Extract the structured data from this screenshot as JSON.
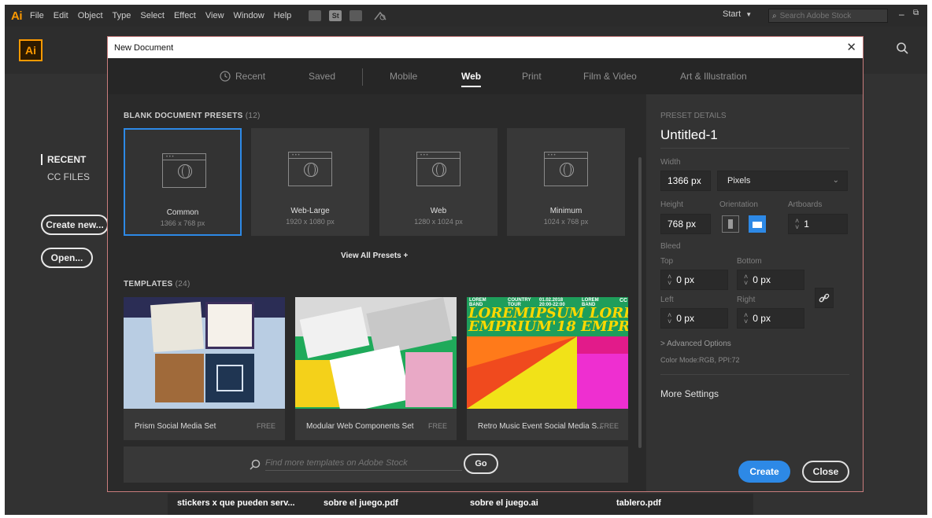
{
  "menubar": {
    "logo": "Ai",
    "items": [
      "File",
      "Edit",
      "Object",
      "Type",
      "Select",
      "Effect",
      "View",
      "Window",
      "Help"
    ],
    "start_label": "Start",
    "stock_search_placeholder": "Search Adobe Stock",
    "toolbar_st_label": "St"
  },
  "home": {
    "logo": "Ai",
    "nav_recent": "RECENT",
    "nav_cc_files": "CC FILES",
    "create_new_label": "Create new...",
    "open_label": "Open...",
    "recent_files": [
      "stickers x que pueden serv...",
      "sobre el juego.pdf",
      "sobre el juego.ai",
      "tablero.pdf"
    ]
  },
  "dialog": {
    "title": "New Document",
    "tabs": [
      {
        "label": "Recent",
        "active": false
      },
      {
        "label": "Saved",
        "active": false
      },
      {
        "label": "Mobile",
        "active": false
      },
      {
        "label": "Web",
        "active": true
      },
      {
        "label": "Print",
        "active": false
      },
      {
        "label": "Film & Video",
        "active": false
      },
      {
        "label": "Art & Illustration",
        "active": false
      }
    ],
    "blank_presets_label": "BLANK DOCUMENT PRESETS",
    "blank_presets_count": "(12)",
    "presets": [
      {
        "name": "Common",
        "size": "1366 x 768 px",
        "selected": true
      },
      {
        "name": "Web-Large",
        "size": "1920 x 1080 px",
        "selected": false
      },
      {
        "name": "Web",
        "size": "1280 x 1024 px",
        "selected": false
      },
      {
        "name": "Minimum",
        "size": "1024 x 768 px",
        "selected": false
      }
    ],
    "view_all_label": "View All Presets +",
    "templates_label": "TEMPLATES",
    "templates_count": "(24)",
    "templates": [
      {
        "name": "Prism Social Media Set",
        "badge": "FREE"
      },
      {
        "name": "Modular Web Components Set",
        "badge": "FREE"
      },
      {
        "name": "Retro Music Event Social Media S...",
        "badge": "FREE"
      }
    ],
    "retro_thumb_text": {
      "lorem": "LOREM",
      "band": "BAND",
      "country": "COUNTRY",
      "tour": "TOUR",
      "date": "01.02.2018",
      "time": "20:00-22:00",
      "cc": "CC",
      "headline1": "LOREMIPSUM",
      "headline1b": "LOREM",
      "headline2": "EMPRIUM'18",
      "headline2b": "EMPRI"
    },
    "template_search_placeholder": "Find more templates on Adobe Stock",
    "go_label": "Go"
  },
  "preset_details": {
    "section_label": "PRESET DETAILS",
    "doc_name": "Untitled-1",
    "width_label": "Width",
    "width_value": "1366 px",
    "units": "Pixels",
    "height_label": "Height",
    "height_value": "768 px",
    "orientation_label": "Orientation",
    "artboards_label": "Artboards",
    "artboards_value": "1",
    "bleed_label": "Bleed",
    "top_label": "Top",
    "top_value": "0 px",
    "bottom_label": "Bottom",
    "bottom_value": "0 px",
    "left_label": "Left",
    "left_value": "0 px",
    "right_label": "Right",
    "right_value": "0 px",
    "advanced_options": "> Advanced Options",
    "color_mode": "Color Mode:RGB, PPI:72",
    "more_settings": "More Settings",
    "create_label": "Create",
    "close_label": "Close"
  },
  "colors": {
    "accent": "#2d89e6",
    "brand_orange": "#ff9a00"
  }
}
